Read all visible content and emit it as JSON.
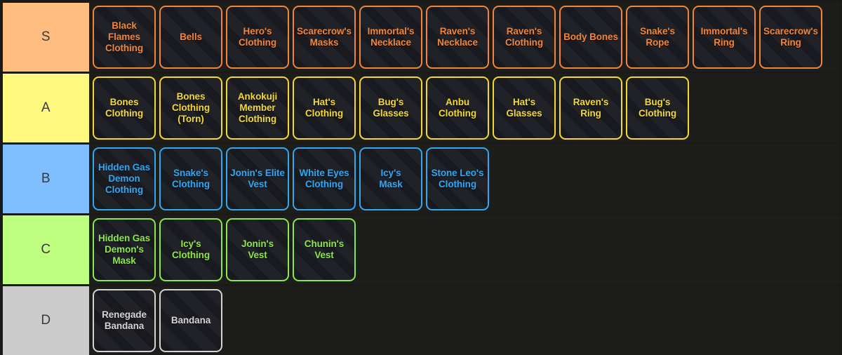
{
  "app": {
    "title": "Tier List"
  },
  "colors": {
    "page_background": "#1a1a1a",
    "row_background": "#1d1e19",
    "card_background": "#181a20",
    "label_text": "#3a3a3a"
  },
  "tiers": [
    {
      "label": "S",
      "label_bg": "#ffbe80",
      "accent": "#f0853c",
      "items": [
        {
          "name": "Black Flames\nClothing"
        },
        {
          "name": "Bells"
        },
        {
          "name": "Hero's\nClothing"
        },
        {
          "name": "Scarecrow's\nMasks"
        },
        {
          "name": "Immortal's\nNecklace"
        },
        {
          "name": "Raven's\nNecklace"
        },
        {
          "name": "Raven's\nClothing"
        },
        {
          "name": "Body Bones"
        },
        {
          "name": "Snake's\nRope"
        },
        {
          "name": "Immortal's\nRing"
        },
        {
          "name": "Scarecrow's\nRing"
        }
      ]
    },
    {
      "label": "A",
      "label_bg": "#fffa7f",
      "accent": "#f5d831",
      "items": [
        {
          "name": "Bones\nClothing"
        },
        {
          "name": "Bones\nClothing\n(Torn)"
        },
        {
          "name": "Ankokuji\nMember\nClothing"
        },
        {
          "name": "Hat's\nClothing"
        },
        {
          "name": "Bug's\nGlasses"
        },
        {
          "name": "Anbu\nClothing"
        },
        {
          "name": "Hat's\nGlasses"
        },
        {
          "name": "Raven's\nRing"
        },
        {
          "name": "Bug's\nClothing"
        }
      ]
    },
    {
      "label": "B",
      "label_bg": "#7fbfff",
      "accent": "#35a7f0",
      "items": [
        {
          "name": "Hidden Gas\nDemon\nClothing"
        },
        {
          "name": "Snake's\nClothing"
        },
        {
          "name": "Jonin's Elite\nVest"
        },
        {
          "name": "White Eyes\nClothing"
        },
        {
          "name": "Icy's\nMask"
        },
        {
          "name": "Stone Leo's\nClothing"
        }
      ]
    },
    {
      "label": "C",
      "label_bg": "#beff7f",
      "accent": "#8ce847",
      "items": [
        {
          "name": "Hidden Gas\nDemon's\nMask"
        },
        {
          "name": "Icy's\nClothing"
        },
        {
          "name": "Jonin's\nVest"
        },
        {
          "name": "Chunin's\nVest"
        }
      ]
    },
    {
      "label": "D",
      "label_bg": "#cccccc",
      "accent": "#d4d4d4",
      "items": [
        {
          "name": "Renegade\nBandana"
        },
        {
          "name": "Bandana"
        }
      ]
    }
  ]
}
